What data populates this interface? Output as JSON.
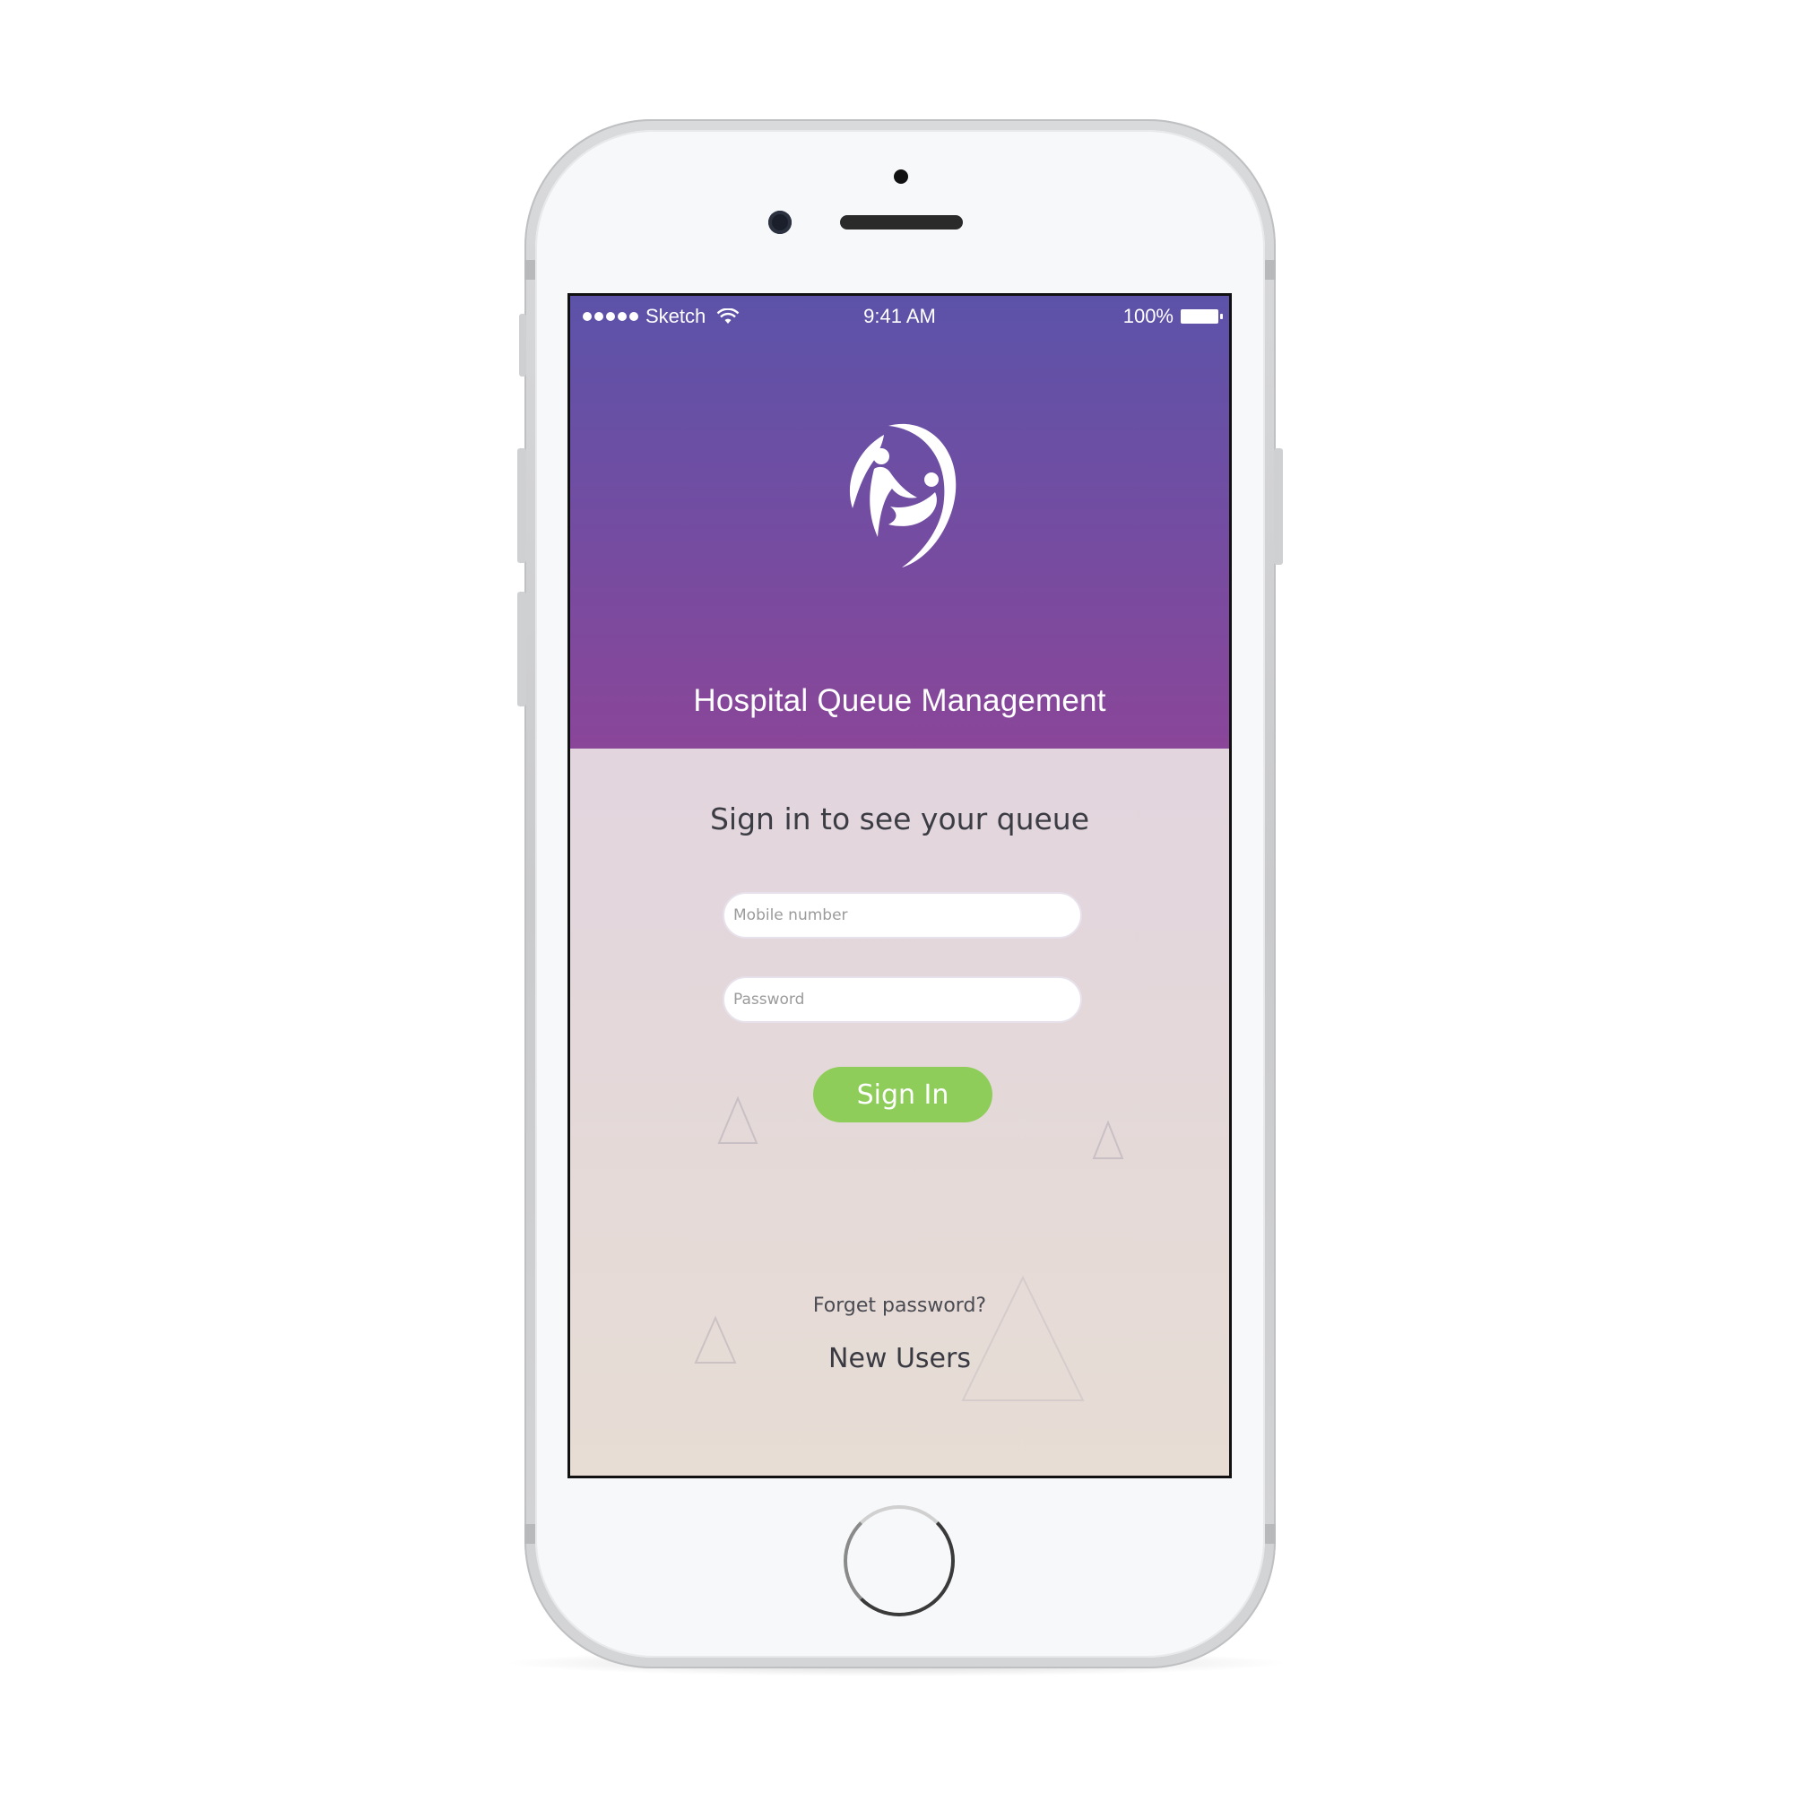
{
  "status_bar": {
    "carrier": "Sketch",
    "time": "9:41 AM",
    "battery": "100%"
  },
  "header": {
    "title": "Hospital Queue Management"
  },
  "signin": {
    "heading": "Sign in to see your queue",
    "mobile_placeholder": "Mobile number",
    "password_placeholder": "Password",
    "button_label": "Sign In"
  },
  "links": {
    "forget_password": "Forget password?",
    "new_users": "New Users"
  },
  "colors": {
    "header_top": "#5c53a9",
    "header_bottom": "#8a4699",
    "signin_button": "#8fcd5a"
  },
  "icons": [
    "signal-dots-icon",
    "wifi-icon",
    "battery-icon",
    "hospital-logo-icon",
    "decorative-triangle-icon"
  ]
}
